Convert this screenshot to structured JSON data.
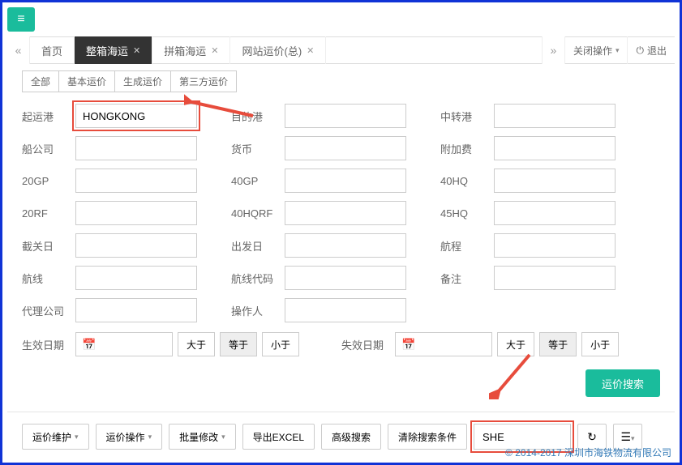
{
  "tabs": {
    "home": "首页",
    "fcl": "整箱海运",
    "lcl": "拼箱海运",
    "site": "网站运价(总)"
  },
  "tabRight": {
    "closeOps": "关闭操作",
    "logout": "退出"
  },
  "pills": {
    "all": "全部",
    "basic": "基本运价",
    "gen": "生成运价",
    "third": "第三方运价"
  },
  "labels": {
    "pol": "起运港",
    "pod": "目的港",
    "via": "中转港",
    "carrier": "船公司",
    "currency": "货币",
    "surcharge": "附加费",
    "g20": "20GP",
    "g40": "40GP",
    "hq40": "40HQ",
    "rf20": "20RF",
    "hqrf40": "40HQRF",
    "hq45": "45HQ",
    "cutoff": "截关日",
    "etd": "出发日",
    "tt": "航程",
    "route": "航线",
    "routecode": "航线代码",
    "remark": "备注",
    "agent": "代理公司",
    "operator": "操作人",
    "effDate": "生效日期",
    "expDate": "失效日期"
  },
  "values": {
    "pol": "HONGKONG",
    "search": "SHE"
  },
  "ops": {
    "gt": "大于",
    "eq": "等于",
    "lt": "小于"
  },
  "buttons": {
    "search": "运价搜索",
    "maintain": "运价维护",
    "operate": "运价操作",
    "batch": "批量修改",
    "export": "导出EXCEL",
    "adv": "高级搜索",
    "clear": "清除搜索条件"
  },
  "footer": {
    "copy": "© 2014-2017 ",
    "company": "深圳市海铁物流有限公司"
  }
}
